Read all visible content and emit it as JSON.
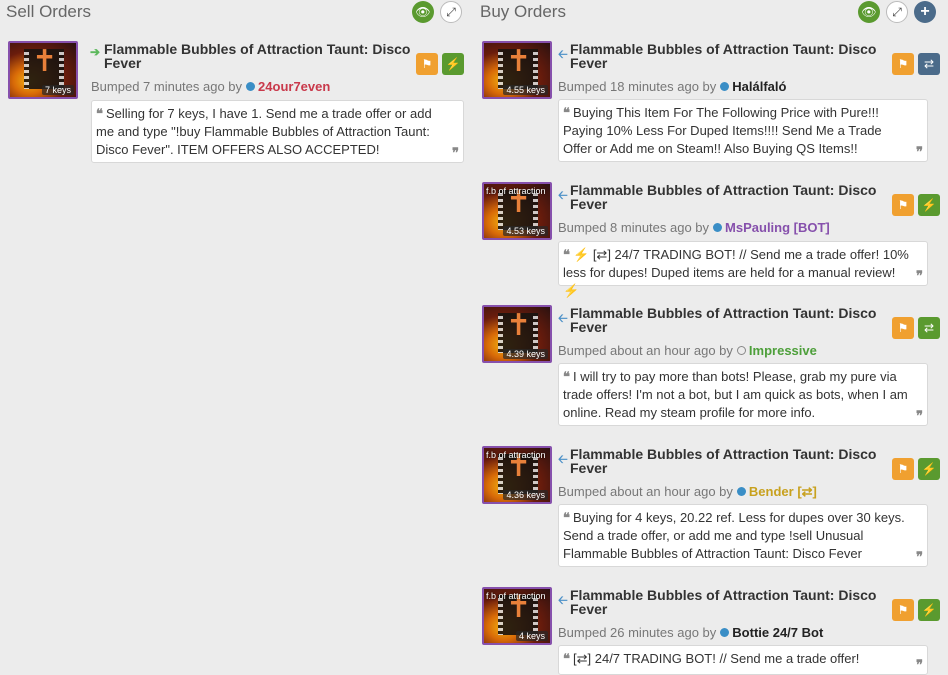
{
  "sell": {
    "title": "Sell Orders",
    "listings": [
      {
        "name": "Flammable Bubbles of Attraction Taunt: Disco Fever",
        "price": "7 keys",
        "caption": "",
        "bumped": "Bumped 7 minutes ago by",
        "user": "24our7even",
        "user_color": "#c9394b",
        "comment": "Selling for 7 keys, I have 1. Send me a trade offer or add me and type \"!buy Flammable Bubbles of Attraction Taunt: Disco Fever\". ITEM OFFERS ALSO ACCEPTED!"
      }
    ]
  },
  "buy": {
    "title": "Buy Orders",
    "listings": [
      {
        "name": "Flammable Bubbles of Attraction Taunt: Disco Fever",
        "price": "4.55 keys",
        "caption": "",
        "bumped": "Bumped 18 minutes ago by",
        "user": "Halálfaló",
        "user_color": "#222222",
        "comment": "Buying This Item For The Following Price with Pure!!! Paying 10% Less For Duped Items!!!! Send Me a Trade Offer or Add me on Steam!! Also Buying QS Items!!"
      },
      {
        "name": "Flammable Bubbles of Attraction Taunt: Disco Fever",
        "price": "4.53 keys",
        "caption": "f.b of attraction",
        "bumped": "Bumped 8 minutes ago by",
        "user": "MsPauling [BOT]",
        "user_color": "#8650ac",
        "comment_pre": "[⇄] 24/7 TRADING BOT! // Send me a trade offer! 10% less for dupes! Duped items are held for a manual review!"
      },
      {
        "name": "Flammable Bubbles of Attraction Taunt: Disco Fever",
        "price": "4.39 keys",
        "caption": "",
        "bumped": "Bumped about an hour ago by",
        "user": "Impressive",
        "user_color": "#4d9f3a",
        "comment": "I will try to pay more than bots! Please, grab my pure via trade offers! I'm not a bot, but I am quick as bots, when I am online. Read my steam profile for more info."
      },
      {
        "name": "Flammable Bubbles of Attraction Taunt: Disco Fever",
        "price": "4.36 keys",
        "caption": "f.b of attraction",
        "bumped": "Bumped about an hour ago by",
        "user": "Bender [⇄]",
        "user_color": "#c8a11e",
        "comment": "Buying for 4 keys, 20.22 ref. Less for dupes over 30 keys. Send a trade offer, or add me and type !sell Unusual Flammable Bubbles of Attraction Taunt: Disco Fever"
      },
      {
        "name": "Flammable Bubbles of Attraction Taunt: Disco Fever",
        "price": "4 keys",
        "caption": "f.b of attraction",
        "bumped": "Bumped 26 minutes ago by",
        "user": "Bottie 24/7 Bot",
        "user_color": "#222222",
        "comment": "[⇄] 24/7 TRADING BOT! // Send me a trade offer!"
      }
    ]
  },
  "icons": {
    "eye": "eye-icon",
    "expand": "expand-icon",
    "plus": "plus-icon",
    "flag": "flag-icon",
    "bolt": "bolt-icon",
    "swap": "swap-icon"
  }
}
